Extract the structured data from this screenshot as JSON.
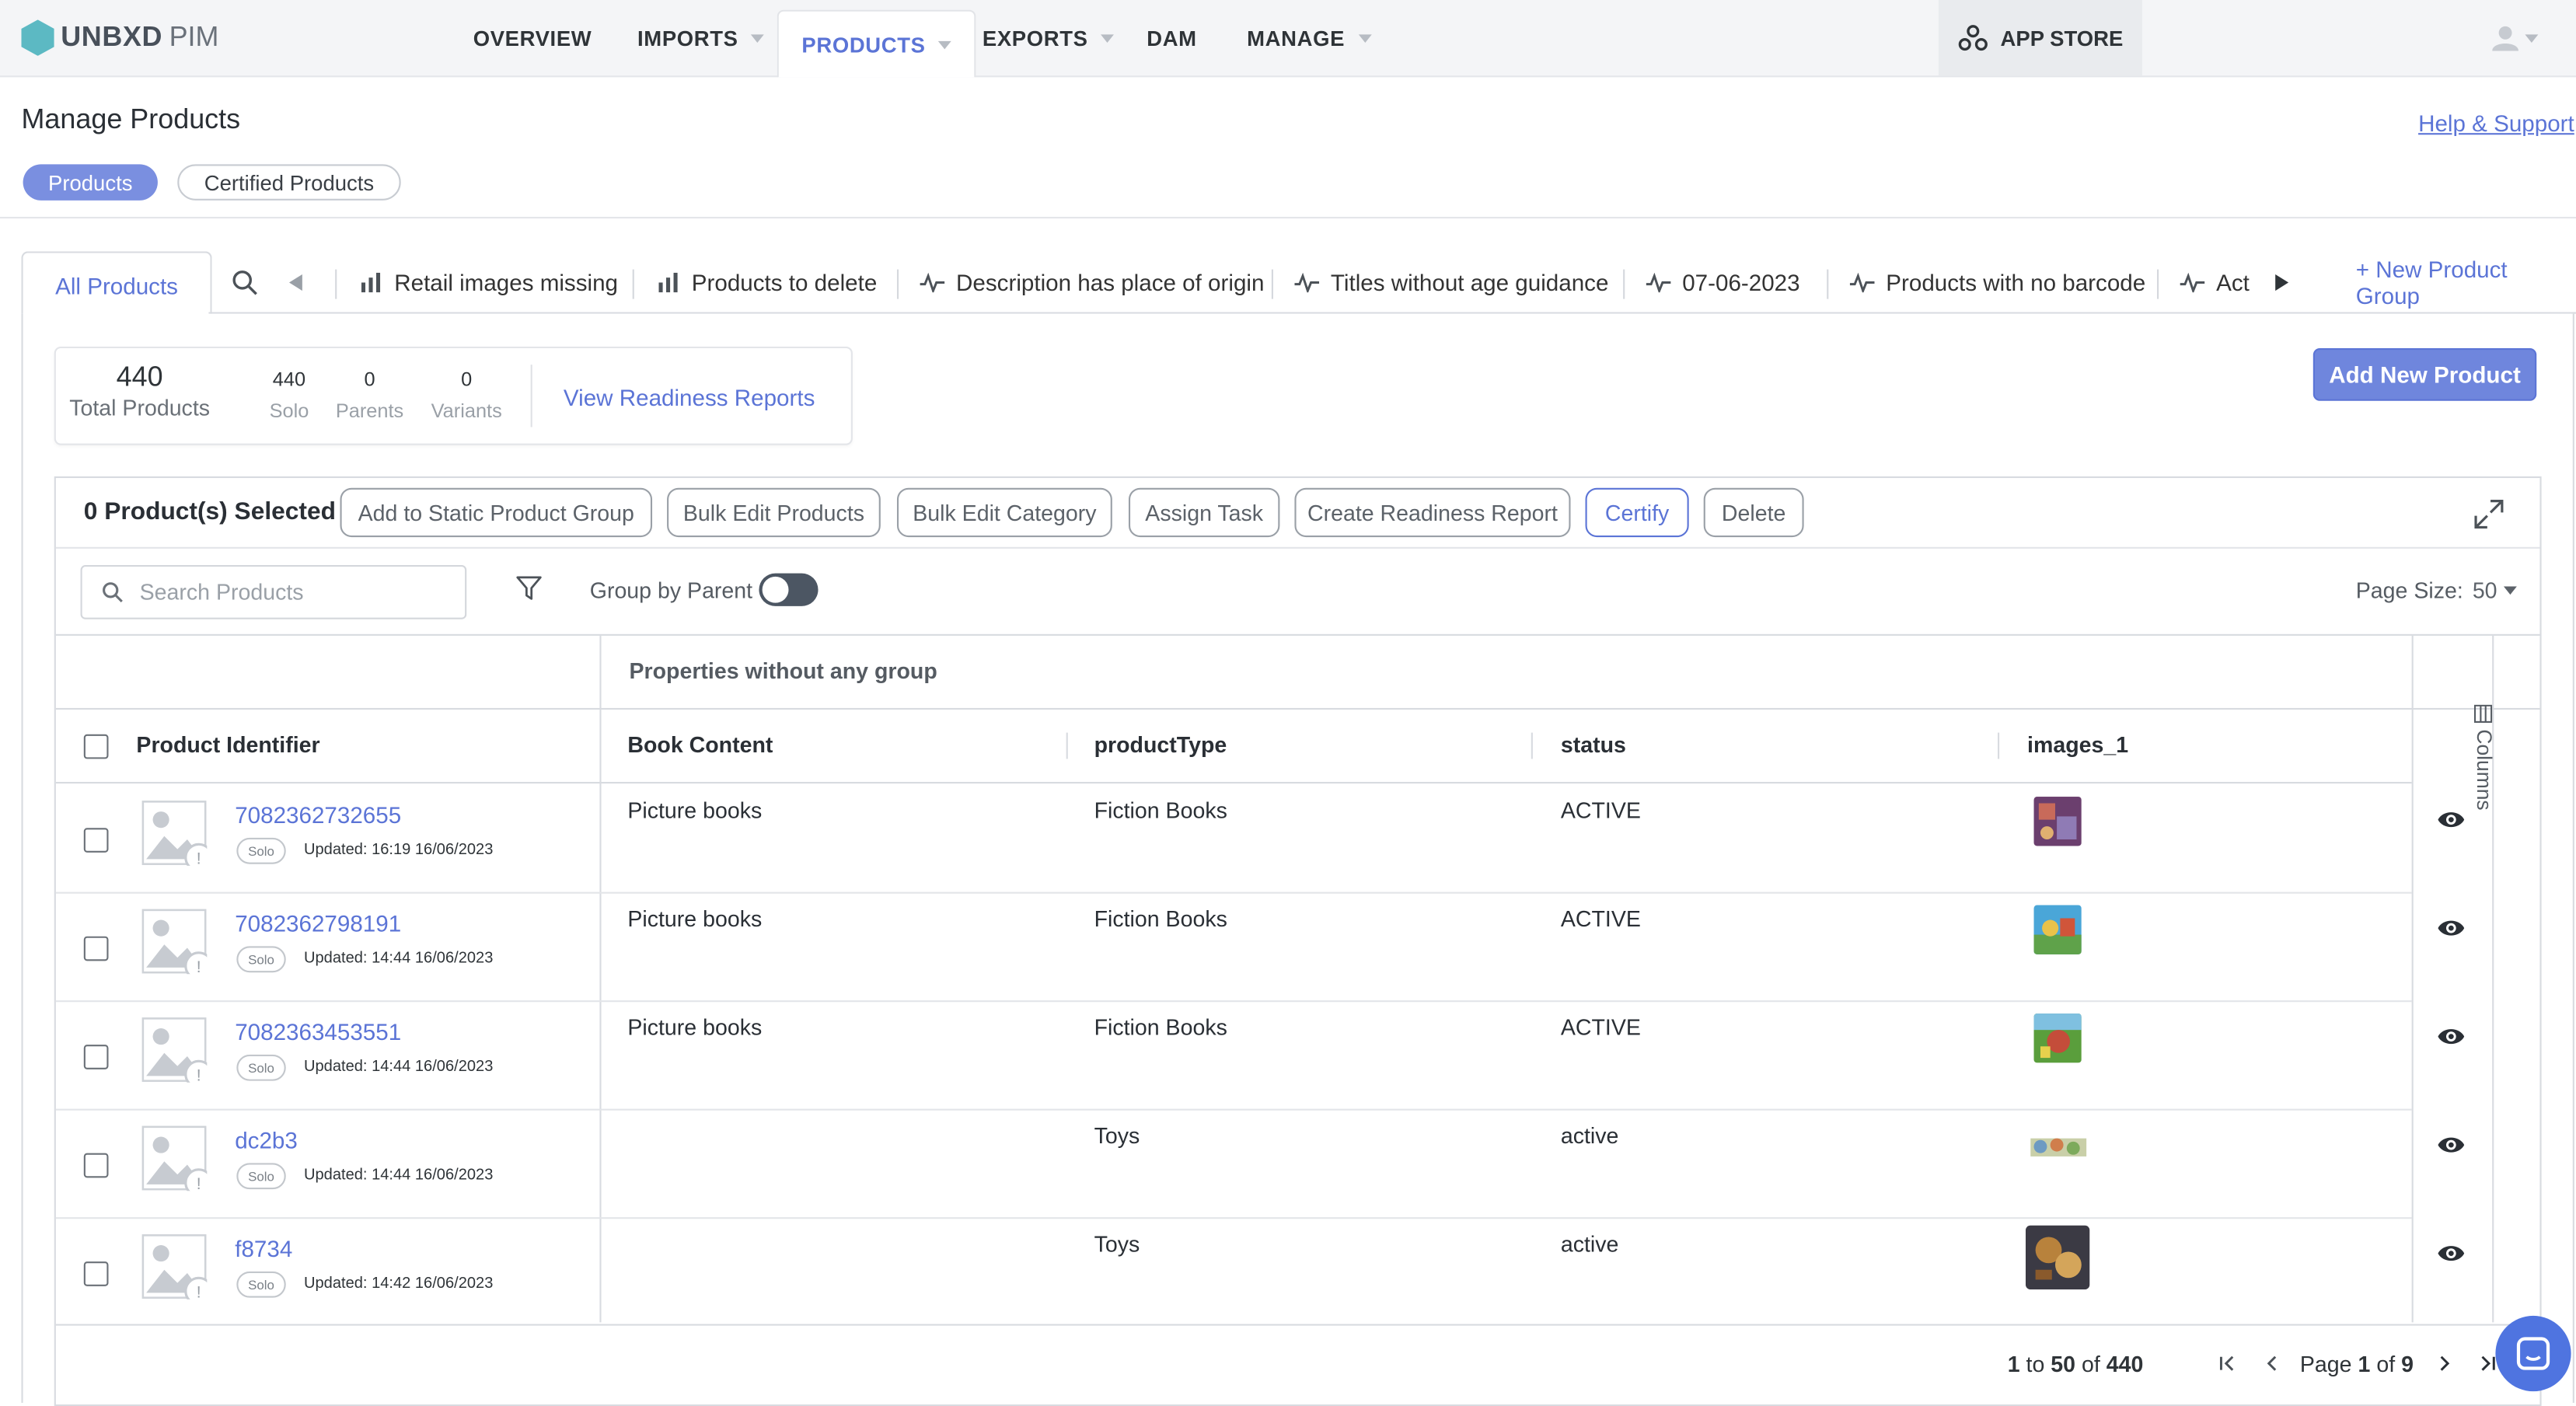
{
  "brand": {
    "name": "UNBXD",
    "suffix": "PIM"
  },
  "nav": {
    "overview": "OVERVIEW",
    "imports": "IMPORTS",
    "products": "PRODUCTS",
    "exports": "EXPORTS",
    "dam": "DAM",
    "manage": "MANAGE",
    "app_store": "APP STORE"
  },
  "page": {
    "title": "Manage Products",
    "help_link": "Help & Support",
    "pills": {
      "products": "Products",
      "certified": "Certified Products"
    }
  },
  "tabs": {
    "active": "All Products",
    "items": [
      "Retail images missing",
      "Products to delete",
      "Description has place of origin",
      "Titles without age guidance",
      "07-06-2023",
      "Products with no barcode",
      "Act"
    ],
    "new_group": "+ New Product Group"
  },
  "stats": {
    "total": "440",
    "total_label": "Total Products",
    "solo": "440",
    "solo_label": "Solo",
    "parents": "0",
    "parents_label": "Parents",
    "variants": "0",
    "variants_label": "Variants",
    "view_reports": "View Readiness Reports"
  },
  "add_new": "Add New Product",
  "actions": {
    "selected": "0 Product(s) Selected",
    "add_static": "Add to Static Product Group",
    "bulk_edit": "Bulk Edit Products",
    "bulk_category": "Bulk Edit Category",
    "assign": "Assign Task",
    "readiness": "Create Readiness Report",
    "certify": "Certify",
    "delete": "Delete"
  },
  "filters": {
    "search_placeholder": "Search Products",
    "group_by_parent": "Group by Parent",
    "page_size_label": "Page Size:",
    "page_size": "50"
  },
  "table": {
    "group_label": "Properties without any group",
    "headers": {
      "identifier": "Product Identifier",
      "book_content": "Book Content",
      "product_type": "productType",
      "status": "status",
      "images": "images_1"
    },
    "columns_label": "Columns",
    "rows": [
      {
        "id": "7082362732655",
        "badge": "Solo",
        "updated": "Updated: 16:19 16/06/2023",
        "book_content": "Picture books",
        "product_type": "Fiction Books",
        "status": "ACTIVE"
      },
      {
        "id": "7082362798191",
        "badge": "Solo",
        "updated": "Updated: 14:44 16/06/2023",
        "book_content": "Picture books",
        "product_type": "Fiction Books",
        "status": "ACTIVE"
      },
      {
        "id": "7082363453551",
        "badge": "Solo",
        "updated": "Updated: 14:44 16/06/2023",
        "book_content": "Picture books",
        "product_type": "Fiction Books",
        "status": "ACTIVE"
      },
      {
        "id": "dc2b3",
        "badge": "Solo",
        "updated": "Updated: 14:44 16/06/2023",
        "book_content": "",
        "product_type": "Toys",
        "status": "active"
      },
      {
        "id": "f8734",
        "badge": "Solo",
        "updated": "Updated: 14:42 16/06/2023",
        "book_content": "",
        "product_type": "Toys",
        "status": "active"
      }
    ]
  },
  "pagination": {
    "from": "1",
    "to_word": "to",
    "to": "50",
    "of_word": "of",
    "total": "440",
    "page_word": "Page",
    "page": "1",
    "of_word2": "of",
    "pages": "9"
  }
}
